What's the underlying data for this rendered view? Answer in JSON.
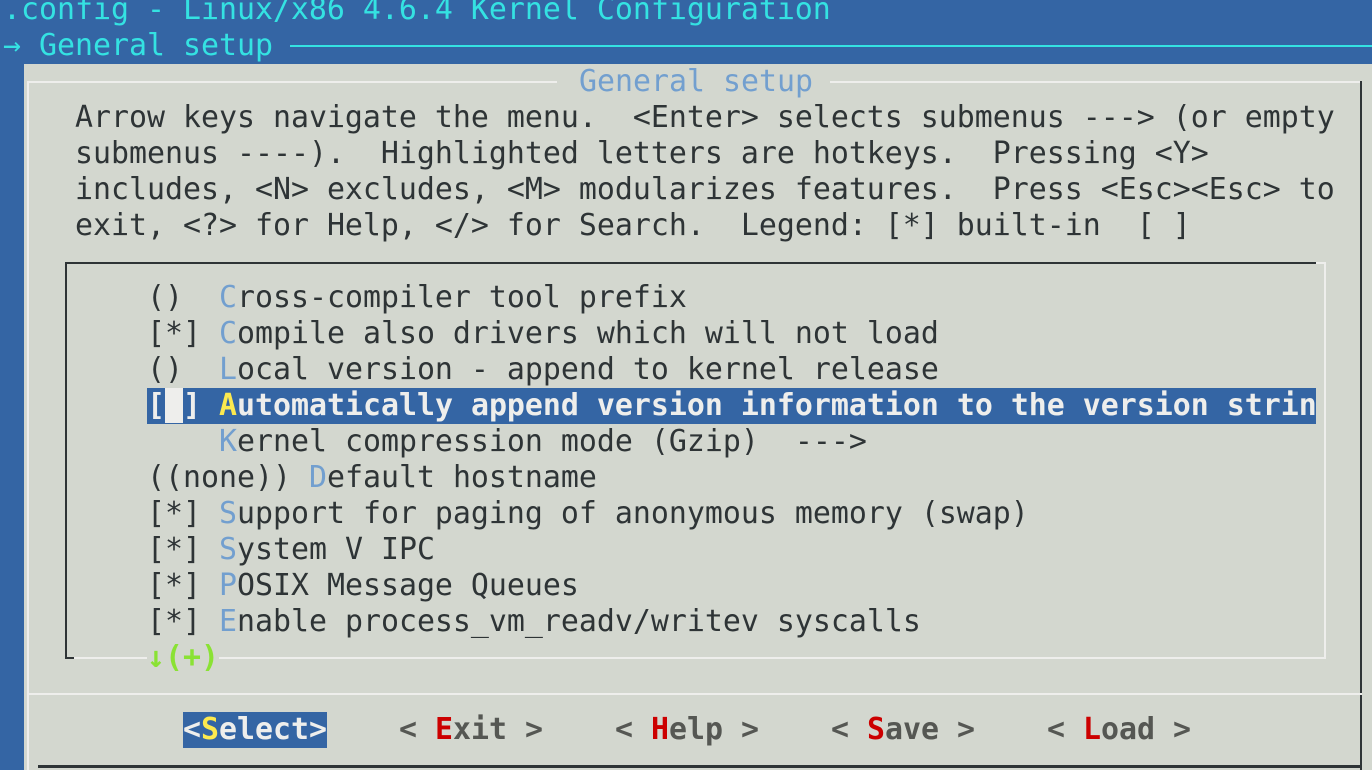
{
  "window_title": ".config - Linux/x86 4.6.4 Kernel Configuration",
  "breadcrumb": {
    "arrow": "→",
    "label": "General setup"
  },
  "dialog": {
    "title": "General setup",
    "help_lines": [
      "Arrow keys navigate the menu.  <Enter> selects submenus ---> (or empty",
      "submenus ----).  Highlighted letters are hotkeys.  Pressing <Y>",
      "includes, <N> excludes, <M> modularizes features.  Press <Esc><Esc> to",
      "exit, <?> for Help, </> for Search.  Legend: [*] built-in  [ ]"
    ],
    "items": [
      {
        "prefix": "()  ",
        "hotkey": "C",
        "rest": "ross-compiler tool prefix"
      },
      {
        "prefix": "[*] ",
        "hotkey": "C",
        "rest": "ompile also drivers which will not load"
      },
      {
        "prefix": "()  ",
        "hotkey": "L",
        "rest": "ocal version - append to kernel release"
      },
      {
        "prefix_open": "[",
        "prefix_cursor": " ",
        "prefix_close": "] ",
        "hotkey": "A",
        "rest": "utomatically append version information to the version strin",
        "selected": true
      },
      {
        "prefix": "    ",
        "hotkey": "K",
        "rest": "ernel compression mode (Gzip)  --->"
      },
      {
        "prefix": "((none)) ",
        "hotkey": "D",
        "rest": "efault hostname"
      },
      {
        "prefix": "[*] ",
        "hotkey": "S",
        "rest": "upport for paging of anonymous memory (swap)"
      },
      {
        "prefix": "[*] ",
        "hotkey": "S",
        "rest": "ystem V IPC"
      },
      {
        "prefix": "[*] ",
        "hotkey": "P",
        "rest": "OSIX Message Queues"
      },
      {
        "prefix": "[*] ",
        "hotkey": "E",
        "rest": "nable process_vm_readv/writev syscalls"
      }
    ],
    "more_indicator": "↓(+)",
    "buttons": [
      {
        "pre": "<",
        "hotkey": "S",
        "post": "elect>",
        "active": true
      },
      {
        "pre": "< ",
        "hotkey": "E",
        "post": "xit >"
      },
      {
        "pre": "< ",
        "hotkey": "H",
        "post": "elp >"
      },
      {
        "pre": "< ",
        "hotkey": "S",
        "post": "ave >"
      },
      {
        "pre": "< ",
        "hotkey": "L",
        "post": "oad >"
      }
    ]
  },
  "colors": {
    "background": "#3465a4",
    "dialog": "#d3d7cf",
    "title_text": "#34e2e2",
    "hotkey": "#729fcf",
    "button_hotkey": "#cc0000",
    "selected_hotkey": "#fce94f",
    "more": "#8ae234"
  }
}
